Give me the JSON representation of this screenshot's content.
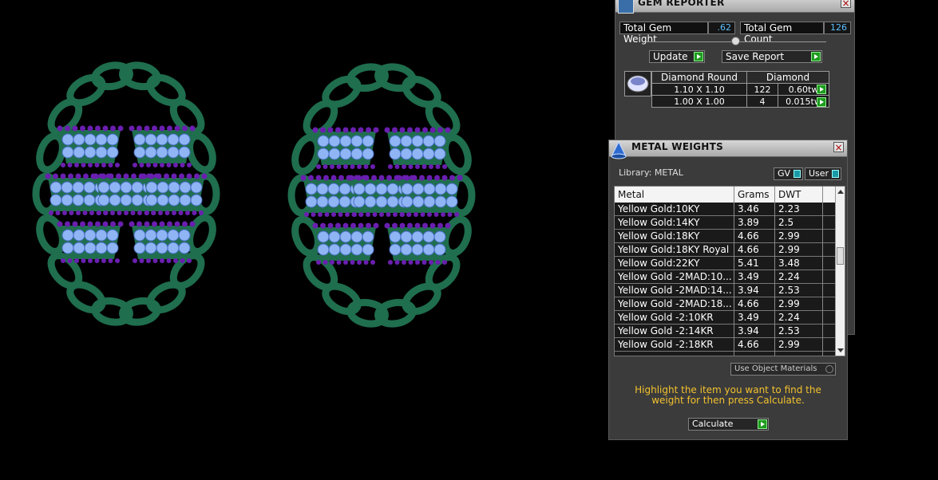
{
  "gem_reporter": {
    "title": "GEM REPORTER",
    "total_weight_label": "Total Gem Weight",
    "total_weight_value": ".62",
    "total_count_label": "Total Gem Count",
    "total_count_value": "126",
    "update_label": "Update",
    "save_report_label": "Save Report",
    "table": {
      "col1": "Diamond Round",
      "col2": "Diamond",
      "rows": [
        {
          "size": "1.10 X 1.10",
          "count": "122",
          "weight": "0.60tw"
        },
        {
          "size": "1.00 X 1.00",
          "count": "4",
          "weight": "0.015tw"
        }
      ]
    }
  },
  "metal_weights": {
    "title": "METAL WEIGHTS",
    "library_label": "Library: METAL",
    "gv_label": "GV",
    "user_label": "User",
    "columns": [
      "Metal",
      "Grams",
      "DWT"
    ],
    "rows": [
      {
        "metal": "Yellow Gold:10KY",
        "grams": "3.46",
        "dwt": "2.23"
      },
      {
        "metal": "Yellow Gold:14KY",
        "grams": "3.89",
        "dwt": "2.5"
      },
      {
        "metal": "Yellow Gold:18KY",
        "grams": "4.66",
        "dwt": "2.99"
      },
      {
        "metal": "Yellow Gold:18KY Royal",
        "grams": "4.66",
        "dwt": "2.99"
      },
      {
        "metal": "Yellow Gold:22KY",
        "grams": "5.41",
        "dwt": "3.48"
      },
      {
        "metal": "Yellow Gold -2MAD:10...",
        "grams": "3.49",
        "dwt": "2.24"
      },
      {
        "metal": "Yellow Gold -2MAD:14...",
        "grams": "3.94",
        "dwt": "2.53"
      },
      {
        "metal": "Yellow Gold -2MAD:18...",
        "grams": "4.66",
        "dwt": "2.99"
      },
      {
        "metal": "Yellow Gold -2:10KR",
        "grams": "3.49",
        "dwt": "2.24"
      },
      {
        "metal": "Yellow Gold -2:14KR",
        "grams": "3.94",
        "dwt": "2.53"
      },
      {
        "metal": "Yellow Gold -2:18KR",
        "grams": "4.66",
        "dwt": "2.99"
      }
    ],
    "use_object_materials_label": "Use Object Materials",
    "instruction": "Highlight the item you want to find the weight for then press Calculate.",
    "calculate_label": "Calculate"
  },
  "colors": {
    "metal_green": "#1f6e4e",
    "gem_light": "#8fb5f5",
    "gem_purple": "#6a1fb0",
    "accent_blue": "#5cc0ff",
    "instruction_yellow": "#f2c12e",
    "arrow_green": "#1f9b1f"
  }
}
